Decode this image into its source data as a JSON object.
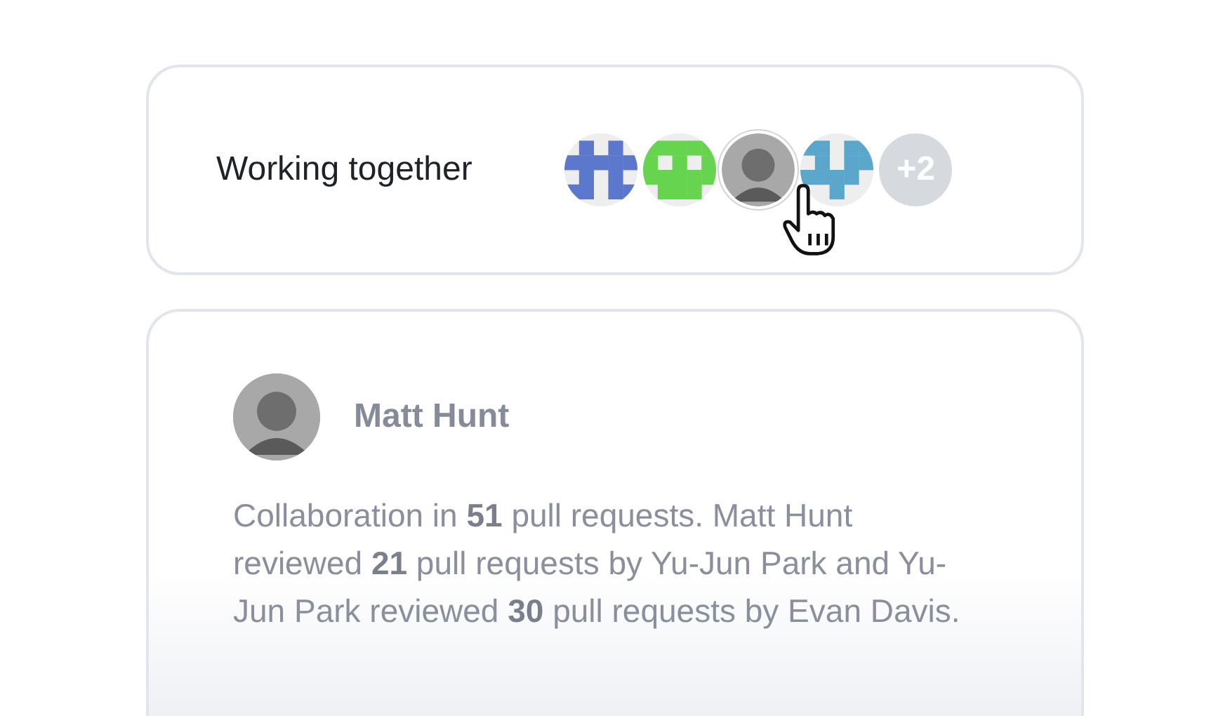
{
  "collaborators_card": {
    "title": "Working together",
    "avatars": [
      {
        "kind": "identicon",
        "color": "#5b78cc",
        "selected": false
      },
      {
        "kind": "identicon",
        "color": "#66d44f",
        "selected": false
      },
      {
        "kind": "photo",
        "selected": true
      },
      {
        "kind": "identicon",
        "color": "#5ba7cb",
        "selected": false
      },
      {
        "kind": "overflow",
        "label": "+2",
        "selected": false
      }
    ]
  },
  "detail_card": {
    "name": "Matt Hunt",
    "summary": "Collaboration in **51** pull requests. Matt Hunt reviewed **21** pull requests by Yu-Jun Park and Yu-Jun Park reviewed **30** pull requests by Evan Davis."
  }
}
